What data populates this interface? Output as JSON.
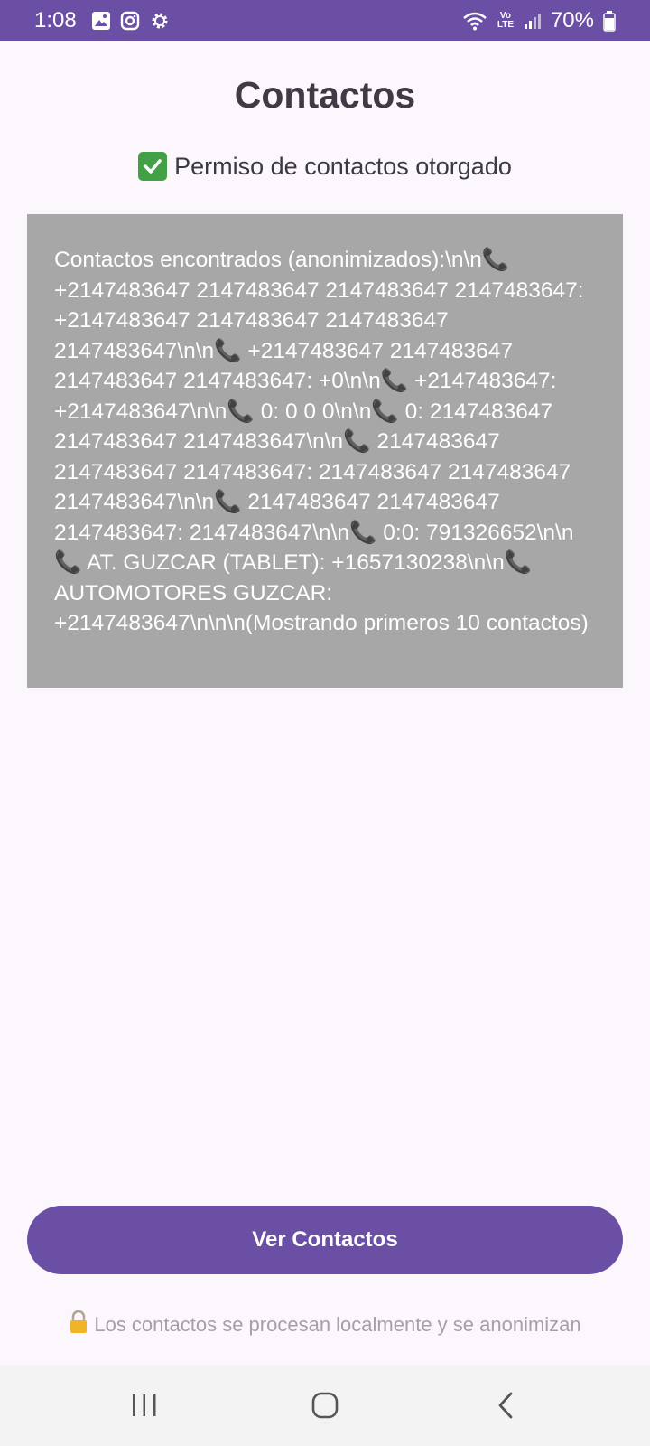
{
  "status_bar": {
    "time": "1:08",
    "network_label": "Vo LTE",
    "battery": "70%"
  },
  "page": {
    "title": "Contactos",
    "permission_icon": "check-mark-icon",
    "permission_text": "Permiso de contactos otorgado"
  },
  "contacts_output": {
    "text": "Contactos encontrados (anonimizados):\\n\\n📞 +2147483647 2147483647 2147483647 2147483647: +2147483647 2147483647 2147483647 2147483647\\n\\n📞 +2147483647 2147483647 2147483647 2147483647: +0\\n\\n📞 +2147483647: +2147483647\\n\\n📞 0: 0 0 0\\n\\n📞 0: 2147483647 2147483647 2147483647\\n\\n📞 2147483647 2147483647 2147483647: 2147483647 2147483647 2147483647\\n\\n📞 2147483647 2147483647 2147483647: 2147483647\\n\\n📞 0:0: 791326652\\n\\n📞 AT. GUZCAR (TABLET): +1657130238\\n\\n📞 AUTOMOTORES GUZCAR: +2147483647\\n\\n\\n(Mostrando primeros 10 contactos)"
  },
  "actions": {
    "view_contacts_label": "Ver Contactos"
  },
  "footer": {
    "lock_icon": "lock-icon",
    "note": "Los contactos se procesan localmente y se anonimizan"
  },
  "colors": {
    "primary": "#6a4fa5",
    "background": "#fcf6fd",
    "output_box": "#a7a7a7"
  }
}
